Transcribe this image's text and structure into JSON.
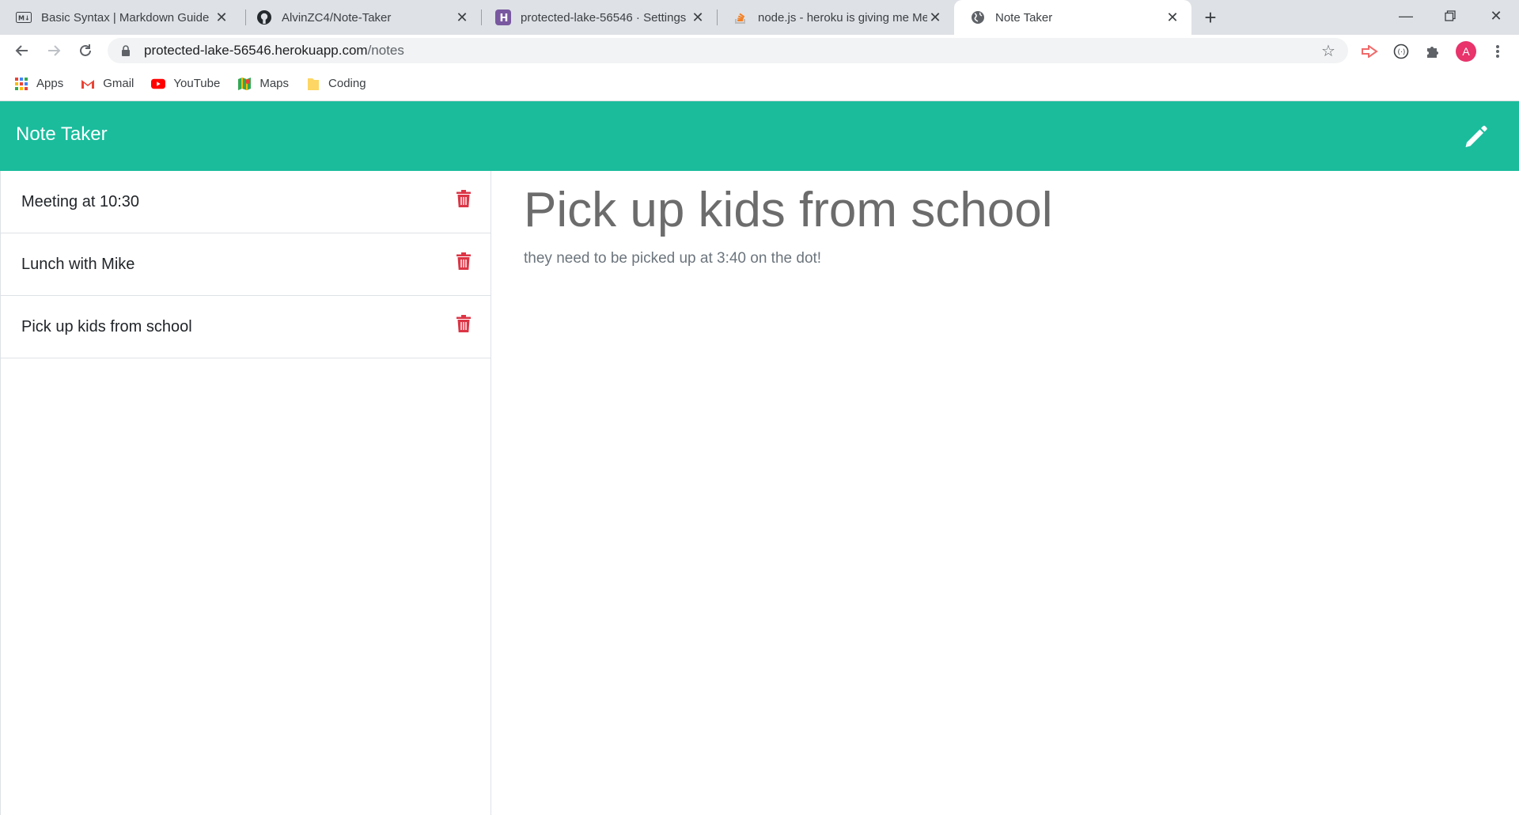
{
  "browser": {
    "tabs": [
      {
        "title": "Basic Syntax | Markdown Guide",
        "icon": "markdown-icon",
        "active": false
      },
      {
        "title": "AlvinZC4/Note-Taker",
        "icon": "github-icon",
        "active": false
      },
      {
        "title": "protected-lake-56546 · Settings |",
        "icon": "heroku-icon",
        "active": false
      },
      {
        "title": "node.js - heroku is giving me Me",
        "icon": "stackoverflow-icon",
        "active": false
      },
      {
        "title": "Note Taker",
        "icon": "globe-icon",
        "active": true
      }
    ],
    "url": {
      "host": "protected-lake-56546.herokuapp.com",
      "path": "/notes"
    },
    "profile_initial": "A",
    "bookmarks": [
      {
        "label": "Apps",
        "icon": "apps-grid-icon"
      },
      {
        "label": "Gmail",
        "icon": "gmail-icon"
      },
      {
        "label": "YouTube",
        "icon": "youtube-icon"
      },
      {
        "label": "Maps",
        "icon": "maps-icon"
      },
      {
        "label": "Coding",
        "icon": "folder-icon"
      }
    ]
  },
  "app": {
    "brand": "Note Taker",
    "accent_color": "#1abc9c",
    "delete_color": "#dc3545",
    "notes": [
      {
        "title": "Meeting at 10:30"
      },
      {
        "title": "Lunch with Mike"
      },
      {
        "title": "Pick up kids from school"
      }
    ],
    "active_note": {
      "title": "Pick up kids from school",
      "text": "they need to be picked up at 3:40 on the dot!"
    }
  }
}
